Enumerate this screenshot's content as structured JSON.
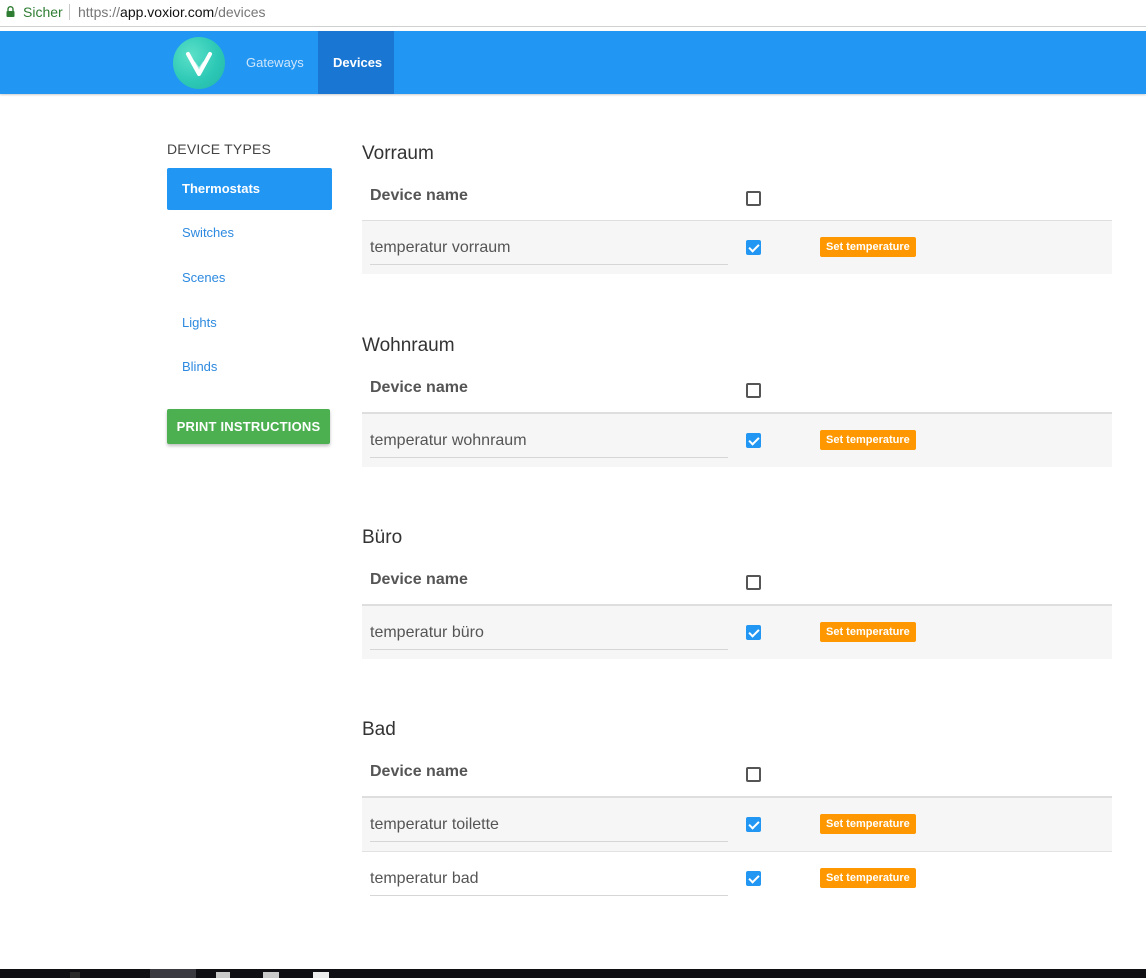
{
  "browser": {
    "secure_label": "Sicher",
    "url_scheme": "https://",
    "url_host": "app.voxior.com",
    "url_path": "/devices"
  },
  "nav": {
    "logo": "voxior-logo-icon",
    "items": [
      {
        "label": "Gateways",
        "active": false
      },
      {
        "label": "Devices",
        "active": true
      }
    ]
  },
  "sidebar": {
    "title": "DEVICE TYPES",
    "items": [
      {
        "label": "Thermostats",
        "active": true
      },
      {
        "label": "Switches",
        "active": false
      },
      {
        "label": "Scenes",
        "active": false
      },
      {
        "label": "Lights",
        "active": false
      },
      {
        "label": "Blinds",
        "active": false
      }
    ],
    "print_button": "PRINT INSTRUCTIONS"
  },
  "table": {
    "header_label": "Device name",
    "action_label": "Set temperature"
  },
  "rooms": [
    {
      "name": "Vorraum",
      "header_checked": false,
      "devices": [
        {
          "name": "temperatur vorraum",
          "checked": true
        }
      ]
    },
    {
      "name": "Wohnraum",
      "header_checked": false,
      "devices": [
        {
          "name": "temperatur wohnraum",
          "checked": true
        }
      ]
    },
    {
      "name": "Büro",
      "header_checked": false,
      "devices": [
        {
          "name": "temperatur büro",
          "checked": true
        }
      ]
    },
    {
      "name": "Bad",
      "header_checked": false,
      "devices": [
        {
          "name": "temperatur toilette",
          "checked": true
        },
        {
          "name": "temperatur bad",
          "checked": true
        }
      ]
    }
  ],
  "colors": {
    "primary": "#2196f3",
    "primary_dark": "#1976d2",
    "success": "#4caf50",
    "warning": "#ff9800"
  }
}
